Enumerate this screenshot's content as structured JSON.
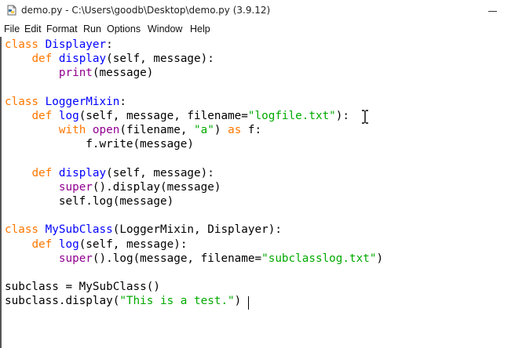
{
  "window": {
    "title": "demo.py - C:\\Users\\goodb\\Desktop\\demo.py (3.9.12)"
  },
  "menu": [
    "File",
    "Edit",
    "Format",
    "Run",
    "Options",
    "Window",
    "Help"
  ],
  "colors": {
    "keyword": "#ff7700",
    "definition": "#0000ff",
    "builtin": "#900090",
    "string": "#00aa00",
    "text": "#000000"
  },
  "code_lines": [
    [
      {
        "t": "kw",
        "v": "class"
      },
      {
        "t": "txt",
        "v": " "
      },
      {
        "t": "def",
        "v": "Displayer"
      },
      {
        "t": "txt",
        "v": ":"
      }
    ],
    [
      {
        "t": "txt",
        "v": "    "
      },
      {
        "t": "kw",
        "v": "def"
      },
      {
        "t": "txt",
        "v": " "
      },
      {
        "t": "def",
        "v": "display"
      },
      {
        "t": "txt",
        "v": "(self, message):"
      }
    ],
    [
      {
        "t": "txt",
        "v": "        "
      },
      {
        "t": "bi",
        "v": "print"
      },
      {
        "t": "txt",
        "v": "(message)"
      }
    ],
    [],
    [
      {
        "t": "kw",
        "v": "class"
      },
      {
        "t": "txt",
        "v": " "
      },
      {
        "t": "def",
        "v": "LoggerMixin"
      },
      {
        "t": "txt",
        "v": ":"
      }
    ],
    [
      {
        "t": "txt",
        "v": "    "
      },
      {
        "t": "kw",
        "v": "def"
      },
      {
        "t": "txt",
        "v": " "
      },
      {
        "t": "def",
        "v": "log"
      },
      {
        "t": "txt",
        "v": "(self, message, filename="
      },
      {
        "t": "str",
        "v": "\"logfile.txt\""
      },
      {
        "t": "txt",
        "v": "):"
      }
    ],
    [
      {
        "t": "txt",
        "v": "        "
      },
      {
        "t": "kw",
        "v": "with"
      },
      {
        "t": "txt",
        "v": " "
      },
      {
        "t": "bi",
        "v": "open"
      },
      {
        "t": "txt",
        "v": "(filename, "
      },
      {
        "t": "str",
        "v": "\"a\""
      },
      {
        "t": "txt",
        "v": ") "
      },
      {
        "t": "kw",
        "v": "as"
      },
      {
        "t": "txt",
        "v": " f:"
      }
    ],
    [
      {
        "t": "txt",
        "v": "            f.write(message)"
      }
    ],
    [],
    [
      {
        "t": "txt",
        "v": "    "
      },
      {
        "t": "kw",
        "v": "def"
      },
      {
        "t": "txt",
        "v": " "
      },
      {
        "t": "def",
        "v": "display"
      },
      {
        "t": "txt",
        "v": "(self, message):"
      }
    ],
    [
      {
        "t": "txt",
        "v": "        "
      },
      {
        "t": "bi",
        "v": "super"
      },
      {
        "t": "txt",
        "v": "().display(message)"
      }
    ],
    [
      {
        "t": "txt",
        "v": "        self.log(message)"
      }
    ],
    [],
    [
      {
        "t": "kw",
        "v": "class"
      },
      {
        "t": "txt",
        "v": " "
      },
      {
        "t": "def",
        "v": "MySubClass"
      },
      {
        "t": "txt",
        "v": "(LoggerMixin, Displayer):"
      }
    ],
    [
      {
        "t": "txt",
        "v": "    "
      },
      {
        "t": "kw",
        "v": "def"
      },
      {
        "t": "txt",
        "v": " "
      },
      {
        "t": "def",
        "v": "log"
      },
      {
        "t": "txt",
        "v": "(self, message):"
      }
    ],
    [
      {
        "t": "txt",
        "v": "        "
      },
      {
        "t": "bi",
        "v": "super"
      },
      {
        "t": "txt",
        "v": "().log(message, filename="
      },
      {
        "t": "str",
        "v": "\"subclasslog.txt\""
      },
      {
        "t": "txt",
        "v": ")"
      }
    ],
    [],
    [
      {
        "t": "txt",
        "v": "subclass = MySubClass()"
      }
    ],
    [
      {
        "t": "txt",
        "v": "subclass.display("
      },
      {
        "t": "str",
        "v": "\"This is a test.\""
      },
      {
        "t": "txt",
        "v": ")"
      }
    ]
  ],
  "icons": {
    "title": "python-file-icon",
    "cursor": "ibeam-cursor-icon",
    "minimize": "minimize-icon"
  }
}
